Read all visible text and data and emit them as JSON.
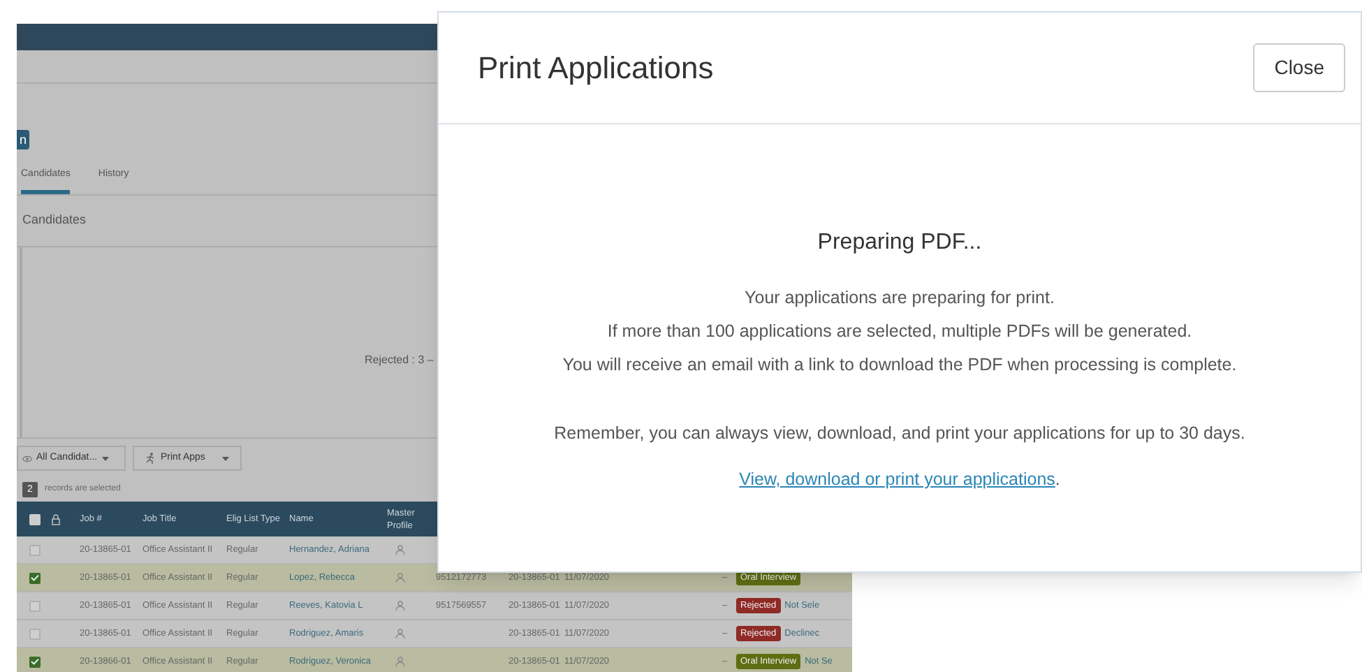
{
  "background_page": {
    "button_fragment": "n",
    "tabs": [
      {
        "label": "Candidates",
        "selected": true
      },
      {
        "label": "History",
        "selected": false
      }
    ],
    "section_title": "Candidates",
    "summary": "Rejected : 3 –",
    "toolbar": {
      "filter": "All Candidat...",
      "print": "Print Apps"
    },
    "selection": {
      "count": "2",
      "text": "records are selected"
    },
    "table": {
      "all_checked": false,
      "columns": [
        "Job #",
        "Job Title",
        "Elig List Type",
        "Name",
        "Master Profile"
      ],
      "rows": [
        {
          "checked": false,
          "job": "20-13865-01",
          "title": "Office Assistant II",
          "type": "Regular",
          "name": "Hernandez, Adriana"
        },
        {
          "checked": true,
          "job": "20-13865-01",
          "title": "Office Assistant II",
          "type": "Regular",
          "name": "Lopez, Rebecca",
          "phone": "9512172773",
          "job_2": "20-13865-01",
          "date": "11/07/2020",
          "dash": "–",
          "status": {
            "label": "Oral Interview",
            "color": "#5e6e12"
          }
        },
        {
          "checked": false,
          "job": "20-13865-01",
          "title": "Office Assistant II",
          "type": "Regular",
          "name": "Reeves, Katovia L",
          "phone": "9517569557",
          "job_2": "20-13865-01",
          "date": "11/07/2020",
          "dash": "–",
          "status": {
            "label": "Rejected",
            "color": "#8f2a26"
          },
          "note": "Not Sele"
        },
        {
          "checked": false,
          "job": "20-13865-01",
          "title": "Office Assistant II",
          "type": "Regular",
          "name": "Rodriguez, Amaris",
          "job_2": "20-13865-01",
          "date": "11/07/2020",
          "dash": "–",
          "status": {
            "label": "Rejected",
            "color": "#8f2a26"
          },
          "note": "Declinec"
        },
        {
          "checked": true,
          "job": "20-13866-01",
          "title": "Office Assistant II",
          "type": "Regular",
          "name": "Rodriguez, Veronica",
          "job_2": "20-13865-01",
          "date": "11/07/2020",
          "dash": "–",
          "status": {
            "label": "Oral Interview",
            "color": "#5e6e12"
          },
          "note": "Not Se"
        }
      ]
    }
  },
  "modal": {
    "title": "Print Applications",
    "close": "Close",
    "heading": "Preparing PDF...",
    "lines": [
      "Your applications are preparing for print.",
      "If more than 100 applications are selected, multiple PDFs will be generated.",
      "You will receive an email with a link to download the PDF when processing is complete."
    ],
    "reminder": "Remember, you can always view, download, and print your applications for up to 30 days.",
    "link": "View, download or print your applications",
    "link_suffix": "."
  }
}
